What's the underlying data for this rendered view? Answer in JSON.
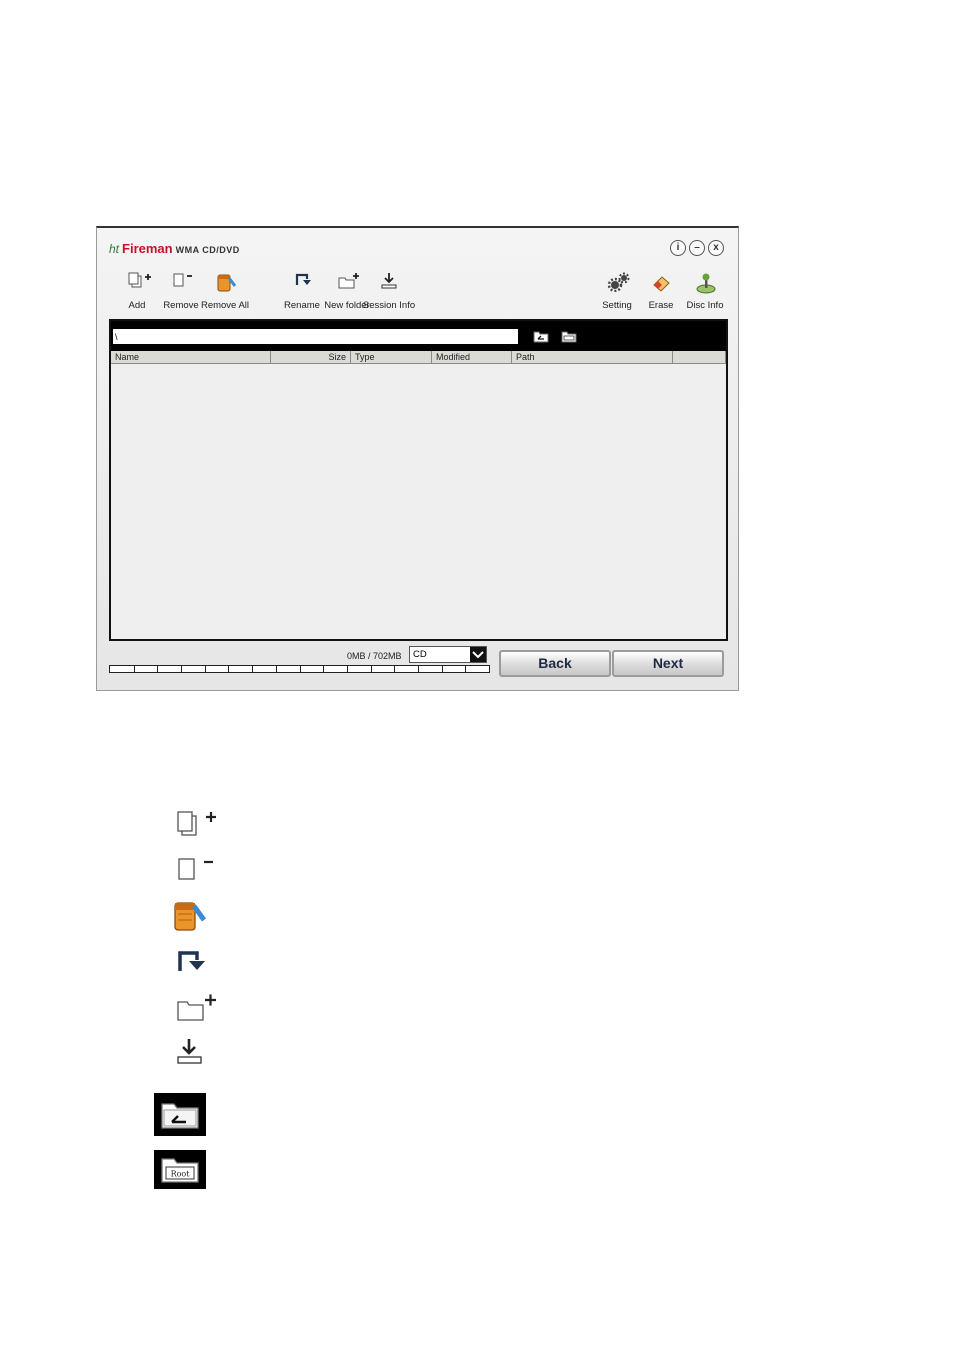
{
  "window": {
    "logo_mark": "ht",
    "app_name": "Fireman",
    "app_subtitle": "WMA CD/DVD",
    "controls": {
      "info": "i",
      "minimize": "–",
      "close": "x"
    }
  },
  "toolbar": {
    "add": "Add",
    "remove": "Remove",
    "remove_all": "Remove All",
    "rename": "Rename",
    "new_folder": "New folder",
    "session_info": "Session Info",
    "setting": "Setting",
    "erase": "Erase",
    "disc_info": "Disc Info"
  },
  "path": {
    "value": "\\"
  },
  "columns": [
    "Name",
    "Size",
    "Type",
    "Modified",
    "Path"
  ],
  "footer": {
    "capacity": "0MB / 702MB",
    "media_selected": "CD",
    "back": "Back",
    "next": "Next"
  },
  "icons": {
    "add": "add-file-icon",
    "remove": "remove-file-icon",
    "remove_all": "trash-bin-icon",
    "rename": "rename-arrow-icon",
    "new_folder": "new-folder-icon",
    "session_info": "download-icon",
    "up_folder": "folder-up-icon",
    "root_folder": "folder-root-icon",
    "setting": "gears-icon",
    "erase": "eraser-icon",
    "disc_info": "joystick-icon"
  },
  "legend": {
    "root_label": "Root"
  }
}
